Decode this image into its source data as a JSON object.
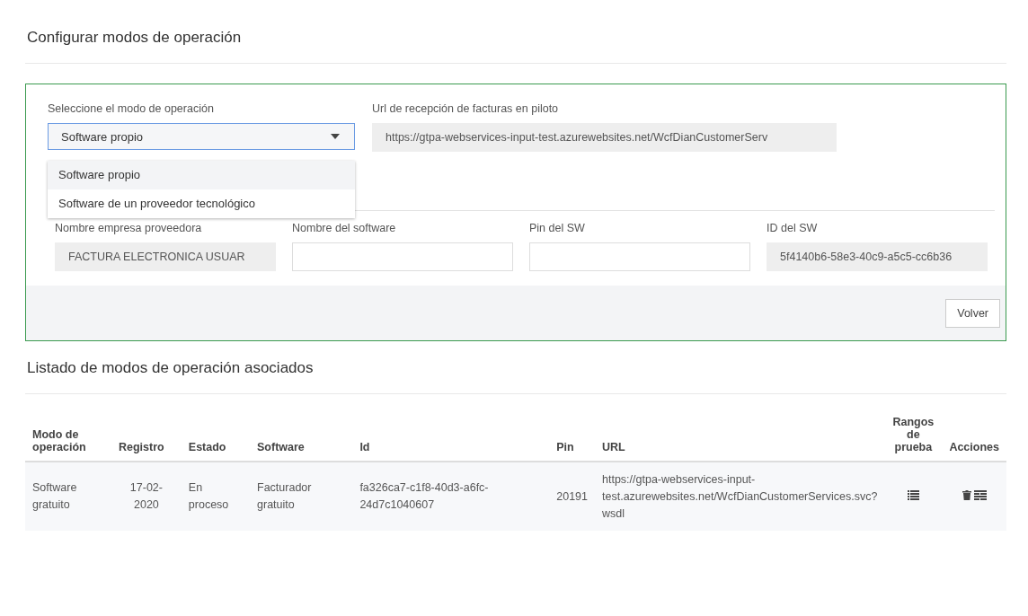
{
  "page_title": "Configurar modos de operación",
  "form": {
    "mode_label": "Seleccione el modo de operación",
    "mode_value": "Software propio",
    "mode_options": [
      {
        "label": "Software propio",
        "selected": true
      },
      {
        "label": "Software de un proveedor tecnológico",
        "selected": false
      }
    ],
    "url_label": "Url de recepción de facturas en piloto",
    "url_value": "https://gtpa-webservices-input-test.azurewebsites.net/WcfDianCustomerServ",
    "fields": [
      {
        "label": "Nombre empresa proveedora",
        "value": "FACTURA ELECTRONICA USUAR",
        "disabled": true
      },
      {
        "label": "Nombre del software",
        "disabled": false
      },
      {
        "label": "Pin del SW",
        "disabled": false
      },
      {
        "label": "ID del SW",
        "value": "5f4140b6-58e3-40c9-a5c5-cc6b36",
        "disabled": true
      }
    ],
    "back_button": "Volver"
  },
  "list_title": "Listado de modos de operación asociados",
  "table": {
    "columns": [
      "Modo de operación",
      "Registro",
      "Estado",
      "Software",
      "Id",
      "Pin",
      "URL",
      "Rangos de prueba",
      "Acciones"
    ],
    "rows": [
      {
        "mode": "Software gratuito",
        "date": "17-02-2020",
        "status": "En proceso",
        "software": "Facturador gratuito",
        "id": "fa326ca7-c1f8-40d3-a6fc-24d7c1040607",
        "pin": "20191",
        "url": "https://gtpa-webservices-input-test.azurewebsites.net/WcfDianCustomerServices.svc?wsdl"
      }
    ]
  }
}
